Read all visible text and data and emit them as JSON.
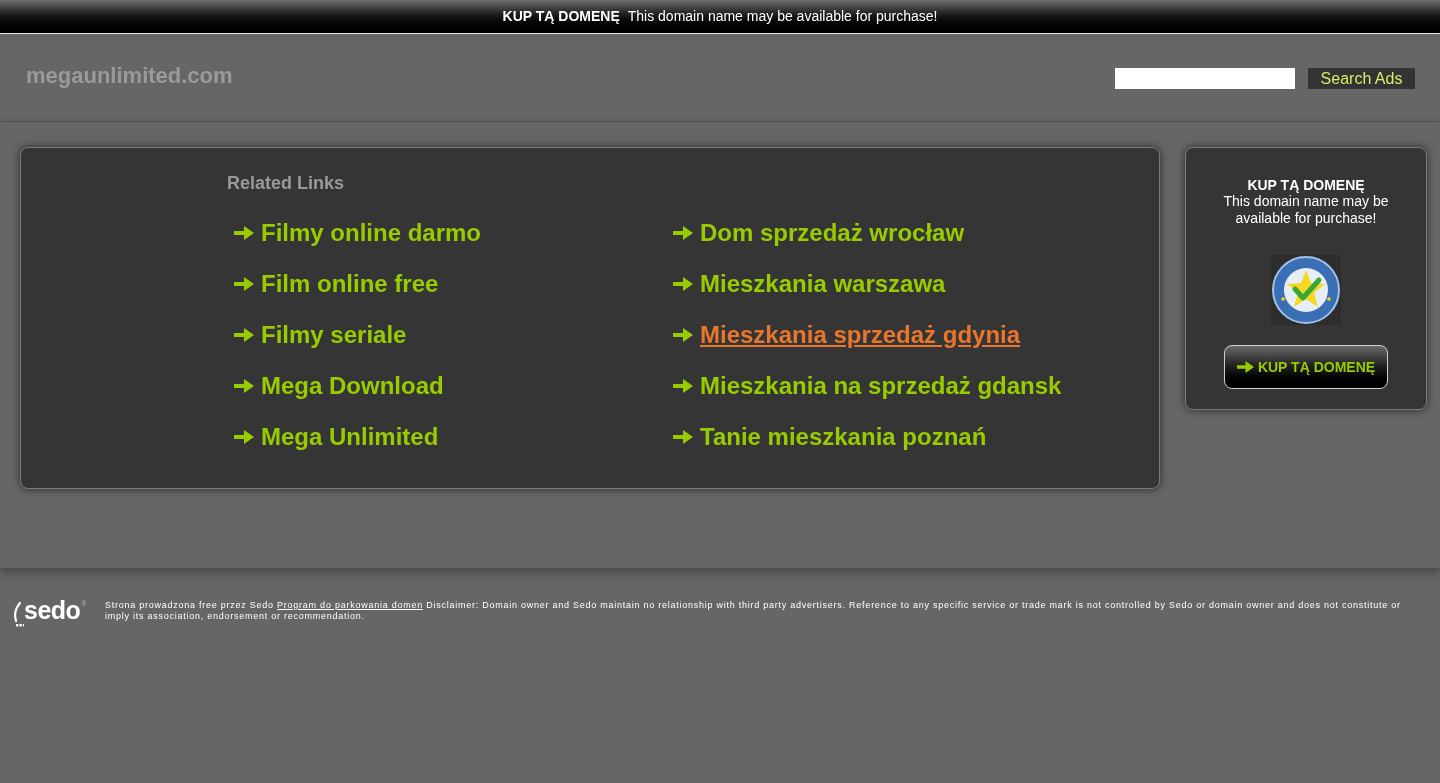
{
  "top_banner": {
    "title": "KUP TĄ DOMENĘ",
    "text": "This domain name may be available for purchase!"
  },
  "header": {
    "site_name": "megaunlimited.com",
    "search_button": "Search Ads"
  },
  "related_links": {
    "heading": "Related Links",
    "links": [
      {
        "label": "Filmy online darmo",
        "hovered": false
      },
      {
        "label": "Film online free",
        "hovered": false
      },
      {
        "label": "Filmy seriale",
        "hovered": false
      },
      {
        "label": "Mega Download",
        "hovered": false
      },
      {
        "label": "Mega Unlimited",
        "hovered": false
      },
      {
        "label": "Dom sprzedaż wrocław",
        "hovered": false
      },
      {
        "label": "Mieszkania warszawa",
        "hovered": false
      },
      {
        "label": "Mieszkania sprzedaż gdynia",
        "hovered": true
      },
      {
        "label": "Mieszkania na sprzedaż gdansk",
        "hovered": false
      },
      {
        "label": "Tanie mieszkania poznań",
        "hovered": false
      }
    ]
  },
  "sidebar": {
    "title": "KUP TĄ DOMENĘ",
    "text": "This domain name may be available for purchase!",
    "button": "KUP TĄ DOMENĘ"
  },
  "footer": {
    "logo": {
      "text": "sedo",
      "registered": "®"
    },
    "text_before": "Strona prowadzona free przez Sedo",
    "link": "Program do parkowania domen",
    "text_after": "Disclaimer: Domain owner and Sedo maintain no relationship with third party advertisers. Reference to any specific service or trade mark is not controlled by Sedo or domain owner and does not constitute or imply its association, endorsement or recommendation."
  }
}
